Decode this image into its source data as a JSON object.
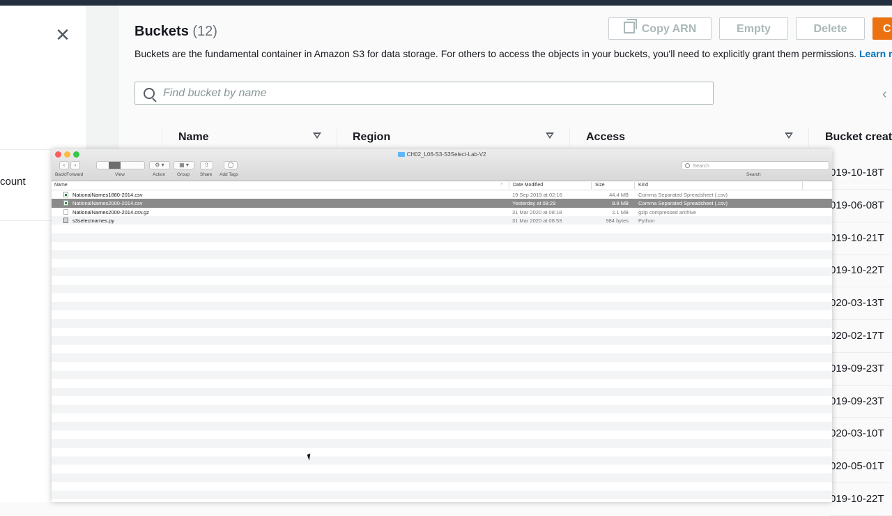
{
  "left_panel": {
    "close_glyph": "✕",
    "nav_fragment": "count"
  },
  "header": {
    "title": "Buckets",
    "count": "(12)",
    "description": "Buckets are the fundamental container in Amazon S3 for data storage. For others to access the objects in your buckets, you'll need to explicitly grant them permissions.",
    "learn_more": "Learn m",
    "buttons": {
      "copy_arn": "Copy ARN",
      "empty": "Empty",
      "delete": "Delete",
      "create": "C"
    }
  },
  "search": {
    "placeholder": "Find bucket by name"
  },
  "pagination": {
    "prev": "‹"
  },
  "table": {
    "columns": [
      "Name",
      "Region",
      "Access",
      "Bucket create"
    ],
    "creation_dates": [
      "019-10-18T",
      "019-06-08T",
      "019-10-21T",
      "019-10-22T",
      "020-03-13T",
      "020-02-17T",
      "019-09-23T",
      "019-09-23T",
      "020-03-10T",
      "020-05-01T",
      "019-10-22T"
    ]
  },
  "finder": {
    "title": "CH02_L06-S3-S3Select-Lab-V2",
    "toolbar": {
      "back": "‹",
      "forward": "›",
      "back_forward_label": "Back/Forward",
      "view_label": "View",
      "action_label": "Action",
      "group_label": "Group",
      "share_label": "Share",
      "add_tags_label": "Add Tags",
      "search_placeholder": "Search",
      "search_label": "Search"
    },
    "columns": {
      "name": "Name",
      "date_modified": "Date Modified",
      "size": "Size",
      "kind": "Kind"
    },
    "files": [
      {
        "name": "NationalNames1880-2014.csv",
        "date": "19 Sep 2019 at 02:16",
        "size": "44.4 MB",
        "kind": "Comma Separated Spreadsheet (.csv)",
        "icon": "csv-file-icon"
      },
      {
        "name": "NationalNames2000-2014.csv",
        "date": "Yesterday at 08:29",
        "size": "8.8 MB",
        "kind": "Comma Separated Spreadsheet (.csv)",
        "icon": "csv-file-icon"
      },
      {
        "name": "NationalNames2000-2014.csv.gz",
        "date": "31 Mar 2020 at 08:18",
        "size": "2.1 MB",
        "kind": "gzip compressed archive",
        "icon": "gzip-file-icon"
      },
      {
        "name": "s3selectnames.py",
        "date": "31 Mar 2020 at 08:53",
        "size": "984 bytes",
        "kind": "Python",
        "icon": "python-file-icon"
      }
    ]
  },
  "colors": {
    "topbar": "#232f3e",
    "primary_button": "#ec7211",
    "link": "#0073bb",
    "selected_row": "#8a8a8a"
  }
}
